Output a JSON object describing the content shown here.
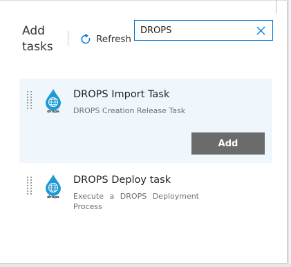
{
  "panel": {
    "title": "Add tasks",
    "refresh_label": "Refresh",
    "search": {
      "value": "DROPS",
      "placeholder": ""
    }
  },
  "tasks": [
    {
      "name": "DROPS Import Task",
      "description": "DROPS Creation Release Task",
      "logo_text": "drops",
      "selected": true,
      "add_label": "Add"
    },
    {
      "name": "DROPS Deploy task",
      "description": "Execute a DROPS Deployment Process",
      "logo_text": "drops",
      "selected": false
    }
  ],
  "icons": [
    "refresh-icon",
    "clear-icon",
    "drag-handle-icon",
    "drops-logo"
  ],
  "colors": {
    "accent": "#0078d4",
    "selected_bg": "#eff6fc",
    "add_button_bg": "#6b6b6b",
    "logo_blue": "#1e9ad6"
  }
}
